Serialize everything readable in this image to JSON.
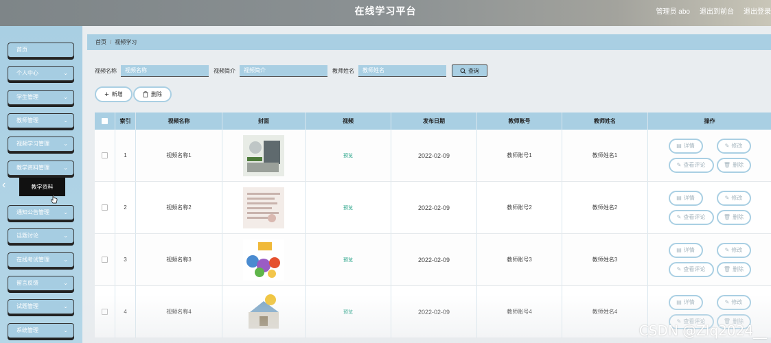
{
  "header": {
    "title": "在线学习平台",
    "user_label": "管理员 abo",
    "back_label": "退出到前台",
    "logout_label": "退出登录"
  },
  "sidebar": {
    "items": [
      {
        "label": "首页",
        "has_chevron": false
      },
      {
        "label": "个人中心",
        "has_chevron": true
      },
      {
        "label": "学生管理",
        "has_chevron": true
      },
      {
        "label": "教师管理",
        "has_chevron": true
      },
      {
        "label": "视频学习管理",
        "has_chevron": true
      },
      {
        "label": "教学资料管理",
        "has_chevron": true
      },
      {
        "label": "通知公告管理",
        "has_chevron": true
      },
      {
        "label": "话题讨论",
        "has_chevron": true
      },
      {
        "label": "在线考试管理",
        "has_chevron": true
      },
      {
        "label": "留言反馈",
        "has_chevron": true
      },
      {
        "label": "试题管理",
        "has_chevron": true
      },
      {
        "label": "系统管理",
        "has_chevron": true
      }
    ],
    "popup_label": "教学资料"
  },
  "breadcrumb": {
    "home": "首页",
    "current": "视频学习"
  },
  "search": {
    "video_name_label": "视频名称",
    "video_name_placeholder": "视频名称",
    "video_intro_label": "视频简介",
    "video_intro_placeholder": "视频简介",
    "teacher_name_label": "教师姓名",
    "teacher_name_placeholder": "教师姓名",
    "query_label": "查询"
  },
  "actions": {
    "add_label": "新增",
    "delete_label": "删除"
  },
  "table": {
    "headers": [
      "索引",
      "视频名称",
      "封面",
      "视频",
      "发布日期",
      "教师账号",
      "教师姓名",
      "操作"
    ],
    "rows": [
      {
        "index": "1",
        "name": "视频名称1",
        "video": "预览",
        "date": "2022-02-09",
        "account": "教师账号1",
        "teacher": "教师姓名1"
      },
      {
        "index": "2",
        "name": "视频名称2",
        "video": "预览",
        "date": "2022-02-09",
        "account": "教师账号2",
        "teacher": "教师姓名2"
      },
      {
        "index": "3",
        "name": "视频名称3",
        "video": "预览",
        "date": "2022-02-09",
        "account": "教师账号3",
        "teacher": "教师姓名3"
      },
      {
        "index": "4",
        "name": "视频名称4",
        "video": "预览",
        "date": "2022-02-09",
        "account": "教师账号4",
        "teacher": "教师姓名4"
      }
    ],
    "op_labels": {
      "detail": "详情",
      "edit": "修改",
      "comments": "查看评论",
      "delete": "删除"
    }
  },
  "watermark": "CSDN @Zlq2024__",
  "colors": {
    "accent": "#a9cfe3",
    "preview": "#2aa58a",
    "sidebar": "#b4d6e7"
  }
}
